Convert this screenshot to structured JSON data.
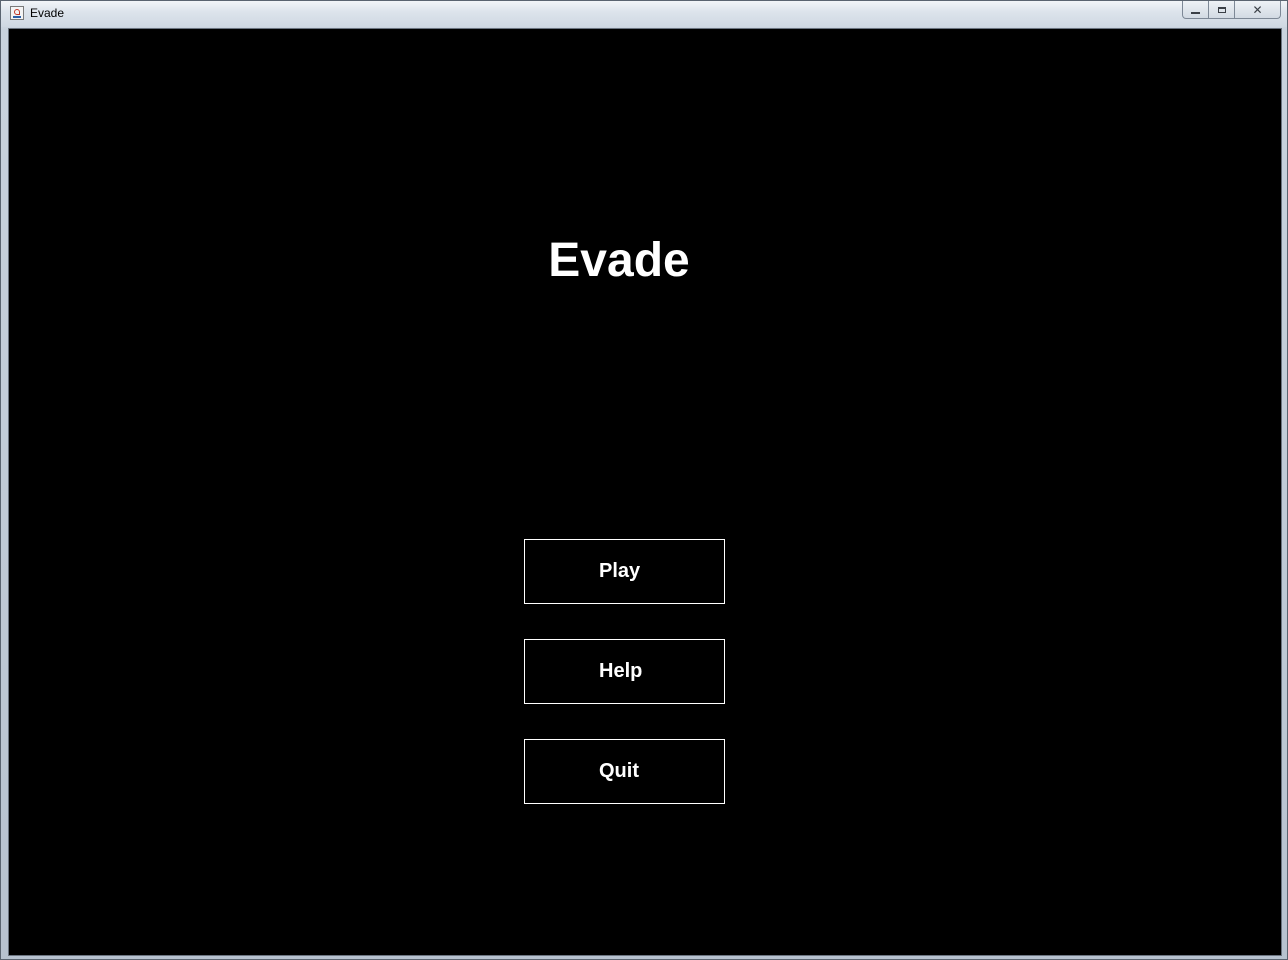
{
  "window": {
    "title": "Evade",
    "app_icon": "java-cup-icon",
    "controls": {
      "minimize_icon": "minimize-icon",
      "maximize_icon": "maximize-icon",
      "close_icon": "close-icon",
      "close_glyph": "✕"
    }
  },
  "game": {
    "background_color": "#000000",
    "title": "Evade",
    "menu": {
      "play_label": "Play",
      "help_label": "Help",
      "quit_label": "Quit"
    }
  }
}
